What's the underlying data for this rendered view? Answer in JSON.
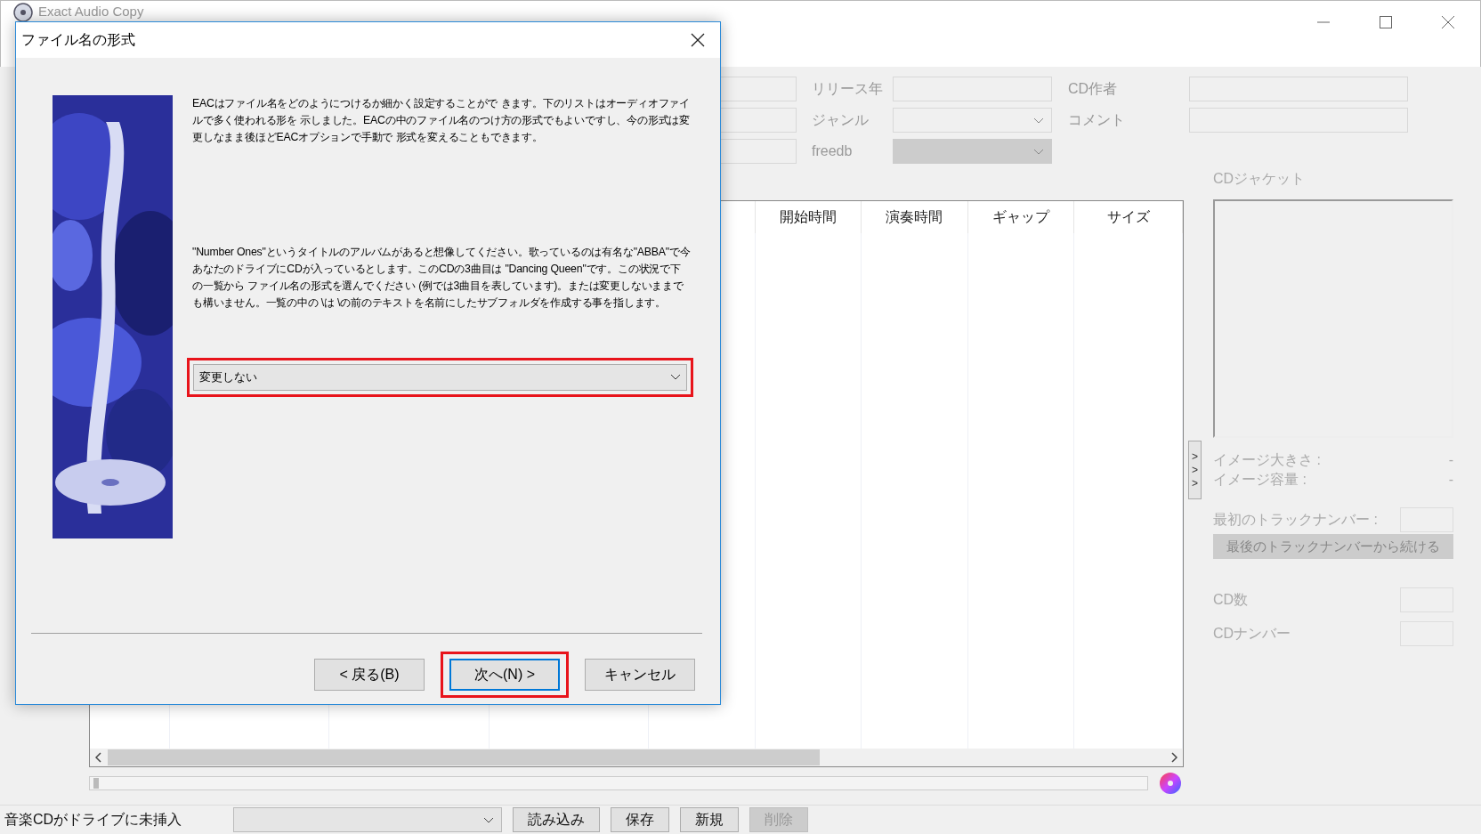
{
  "main_window": {
    "title": "Exact Audio Copy"
  },
  "field_rows": [
    {
      "items": [
        {
          "label": "リリース年",
          "kind": "text",
          "disabled": false
        },
        {
          "label": "CD作者",
          "kind": "text",
          "disabled": false
        }
      ]
    },
    {
      "items": [
        {
          "label": "ジャンル",
          "kind": "combo",
          "disabled": false
        },
        {
          "label": "コメント",
          "kind": "text",
          "disabled": false
        }
      ]
    },
    {
      "items": [
        {
          "label": "freedb",
          "kind": "combo",
          "disabled": true
        }
      ]
    }
  ],
  "table": {
    "columns": [
      "開始時間",
      "演奏時間",
      "ギャップ",
      "サイズ"
    ]
  },
  "position_slider": {
    "level": 0
  },
  "cover_panel": {
    "title": "CDジャケット",
    "expand_glyphs": [
      ">",
      ">",
      ">"
    ],
    "info": [
      {
        "label": "イメージ大きさ :",
        "value": "-"
      },
      {
        "label": "イメージ容量 :",
        "value": "-"
      }
    ],
    "first_track_label": "最初のトラックナンバー :",
    "continue_button": "最後のトラックナンバーから続ける",
    "cd_count_label": "CD数",
    "cd_number_label": "CDナンバー"
  },
  "status_bar": {
    "message": "音楽CDがドライブに未挿入",
    "buttons": [
      {
        "label": "読み込み",
        "disabled": false
      },
      {
        "label": "保存",
        "disabled": false
      },
      {
        "label": "新規",
        "disabled": false
      },
      {
        "label": "削除",
        "disabled": true
      }
    ]
  },
  "dialog": {
    "title": "ファイル名の形式",
    "paragraphs": [
      "EACはファイル名をどのようにつけるか細かく設定することがで きます。下のリストはオーディオファイルで多く使われる形を 示しました。EACの中のファイル名のつけ方の形式でもよいですし、今の形式は変更しなまま後ほどEACオプションで手動で 形式を変えることもできます。",
      "\"Number Ones\"というタイトルのアルバムがあると想像してください。歌っているのは有名な\"ABBA\"で今あなたのドライブにCDが入っているとします。このCDの3曲目は \"Dancing Queen\"です。この状況で下の一覧から ファイル名の形式を選んでください (例では3曲目を表しています)。または変更しないままでも構いません。一覧の中の \\は \\の前のテキストを名前にしたサブフォルダを作成する事を指します。"
    ],
    "format_select": {
      "value": "変更しない",
      "highlighted": true
    },
    "buttons": [
      {
        "label": "< 戻る(B)",
        "default": false,
        "highlighted": false
      },
      {
        "label": "次へ(N) >",
        "default": true,
        "highlighted": true
      },
      {
        "label": "キャンセル",
        "default": false,
        "highlighted": false
      }
    ]
  }
}
